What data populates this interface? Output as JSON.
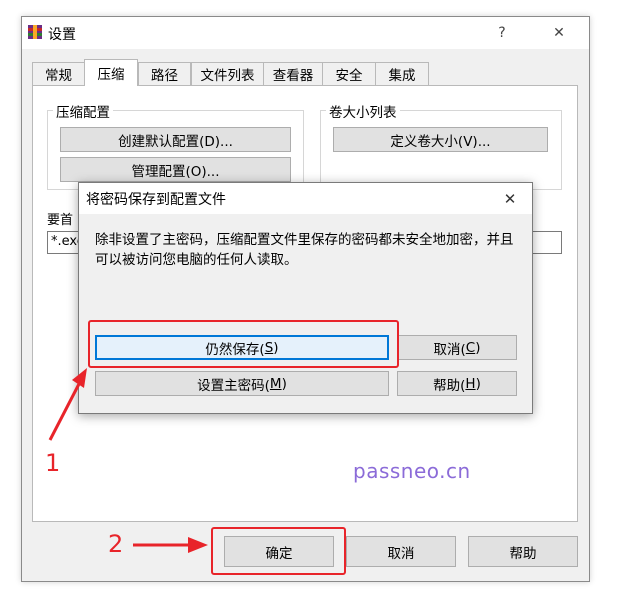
{
  "window": {
    "title": "设置",
    "help_glyph": "?",
    "close_glyph": "✕"
  },
  "tabs": [
    "常规",
    "压缩",
    "路径",
    "文件列表",
    "查看器",
    "安全",
    "集成"
  ],
  "compression_group": {
    "label": "压缩配置",
    "create_default": "创建默认配置(D)...",
    "manage": "管理配置(O)..."
  },
  "volume_group": {
    "label": "卷大小列表",
    "define": "定义卷大小(V)..."
  },
  "exclude": {
    "label_partial": "要首",
    "value_partial": "*.exe"
  },
  "dialog": {
    "title": "将密码保存到配置文件",
    "message": "除非设置了主密码，压缩配置文件里保存的密码都未安全地加密，并且可以被访问您电脑的任何人读取。",
    "save_anyway": {
      "text": "仍然保存(",
      "key": "S",
      "end": ")"
    },
    "cancel": {
      "text": "取消(",
      "key": "C",
      "end": ")"
    },
    "set_master": {
      "text": "设置主密码(",
      "key": "M",
      "end": ")"
    },
    "help": {
      "text": "帮助(",
      "key": "H",
      "end": ")"
    },
    "close_glyph": "✕"
  },
  "footer": {
    "ok": "确定",
    "cancel": "取消",
    "help": "帮助"
  },
  "annotations": {
    "step1": "1",
    "step2": "2"
  },
  "watermark": "passneo.cn",
  "colors": {
    "annotation_red": "#e8242a",
    "watermark_purple": "#8b6bd8",
    "focus_blue": "#0078d7"
  }
}
